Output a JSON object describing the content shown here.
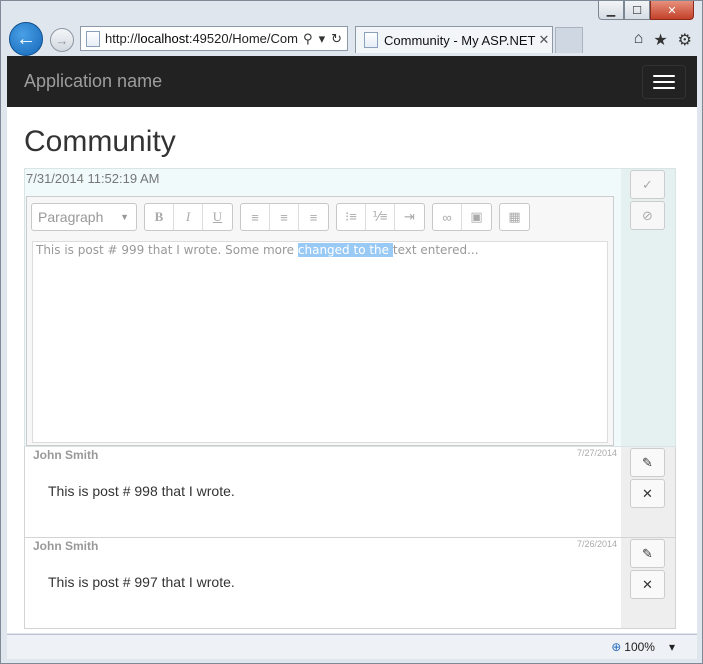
{
  "browser": {
    "address_url_prefix": "http://",
    "address_url_host": "localhost",
    "address_url_rest": ":49520/Home/Com",
    "tab_title": "Community - My ASP.NET ...",
    "zoom_level": "100%"
  },
  "site": {
    "brand": "Application name"
  },
  "page": {
    "title": "Community"
  },
  "editor_post": {
    "timestamp": "7/31/2014 11:52:19 AM",
    "format_select": "Paragraph",
    "text_before": "This is post # 999 that I wrote. Some more ",
    "text_selected": "changed to the ",
    "text_after": "text entered..."
  },
  "posts": [
    {
      "author": "John Smith",
      "date": "7/27/2014",
      "body": "This is post # 998 that I wrote."
    },
    {
      "author": "John Smith",
      "date": "7/26/2014",
      "body": "This is post # 997 that I wrote."
    }
  ]
}
